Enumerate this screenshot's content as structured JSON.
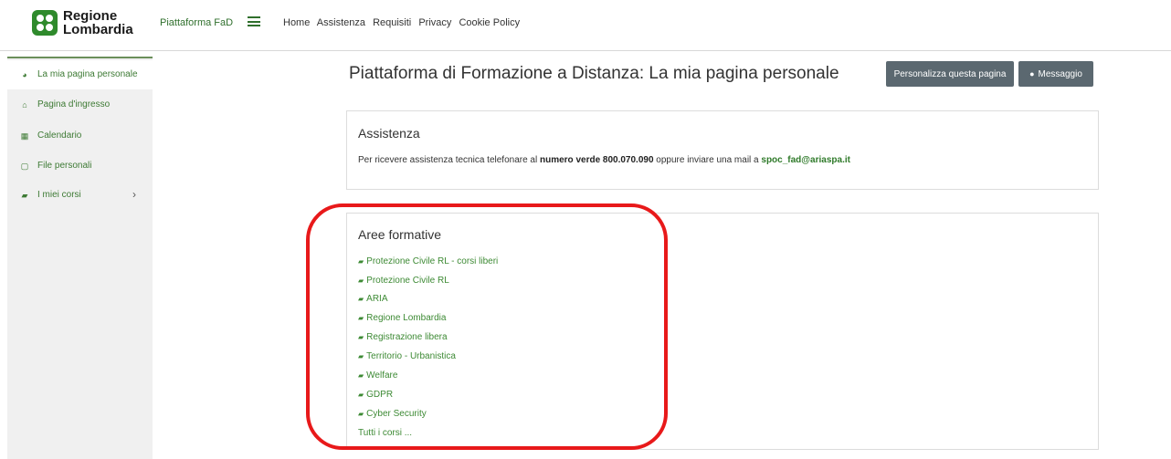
{
  "header": {
    "logo_line1": "Regione",
    "logo_line2": "Lombardia",
    "platform_link": "Piattaforma FaD",
    "nav": [
      "Home",
      "Assistenza",
      "Requisiti",
      "Privacy",
      "Cookie Policy"
    ]
  },
  "sidebar": {
    "items": [
      {
        "label": "La mia pagina personale",
        "icon": "dashboard-icon",
        "glyph": "◕"
      },
      {
        "label": "Pagina d'ingresso",
        "icon": "home-icon",
        "glyph": "⌂"
      },
      {
        "label": "Calendario",
        "icon": "calendar-icon",
        "glyph": "▦"
      },
      {
        "label": "File personali",
        "icon": "file-icon",
        "glyph": "▢"
      },
      {
        "label": "I miei corsi",
        "icon": "graduation-cap-icon",
        "glyph": "▰"
      }
    ]
  },
  "main": {
    "title": "Piattaforma di Formazione a Distanza: La mia pagina personale",
    "customize_button": "Personalizza questa pagina",
    "message_button": "Messaggio"
  },
  "assistenza": {
    "title": "Assistenza",
    "text_before": "Per ricevere assistenza tecnica telefonare al ",
    "text_bold": "numero verde 800.070.090",
    "text_middle": " oppure inviare una mail a ",
    "email": "spoc_fad@ariaspa.it"
  },
  "aree": {
    "title": "Aree formative",
    "courses": [
      "Protezione Civile RL - corsi liberi",
      "Protezione Civile RL",
      "ARIA",
      "Regione Lombardia",
      "Registrazione libera",
      "Territorio - Urbanistica",
      "Welfare",
      "GDPR",
      "Cyber Security"
    ],
    "all_courses": "Tutti i corsi ..."
  },
  "colors": {
    "accent_green": "#3d8a34",
    "button_gray": "#5b6870",
    "highlight_red": "#e8191a"
  }
}
